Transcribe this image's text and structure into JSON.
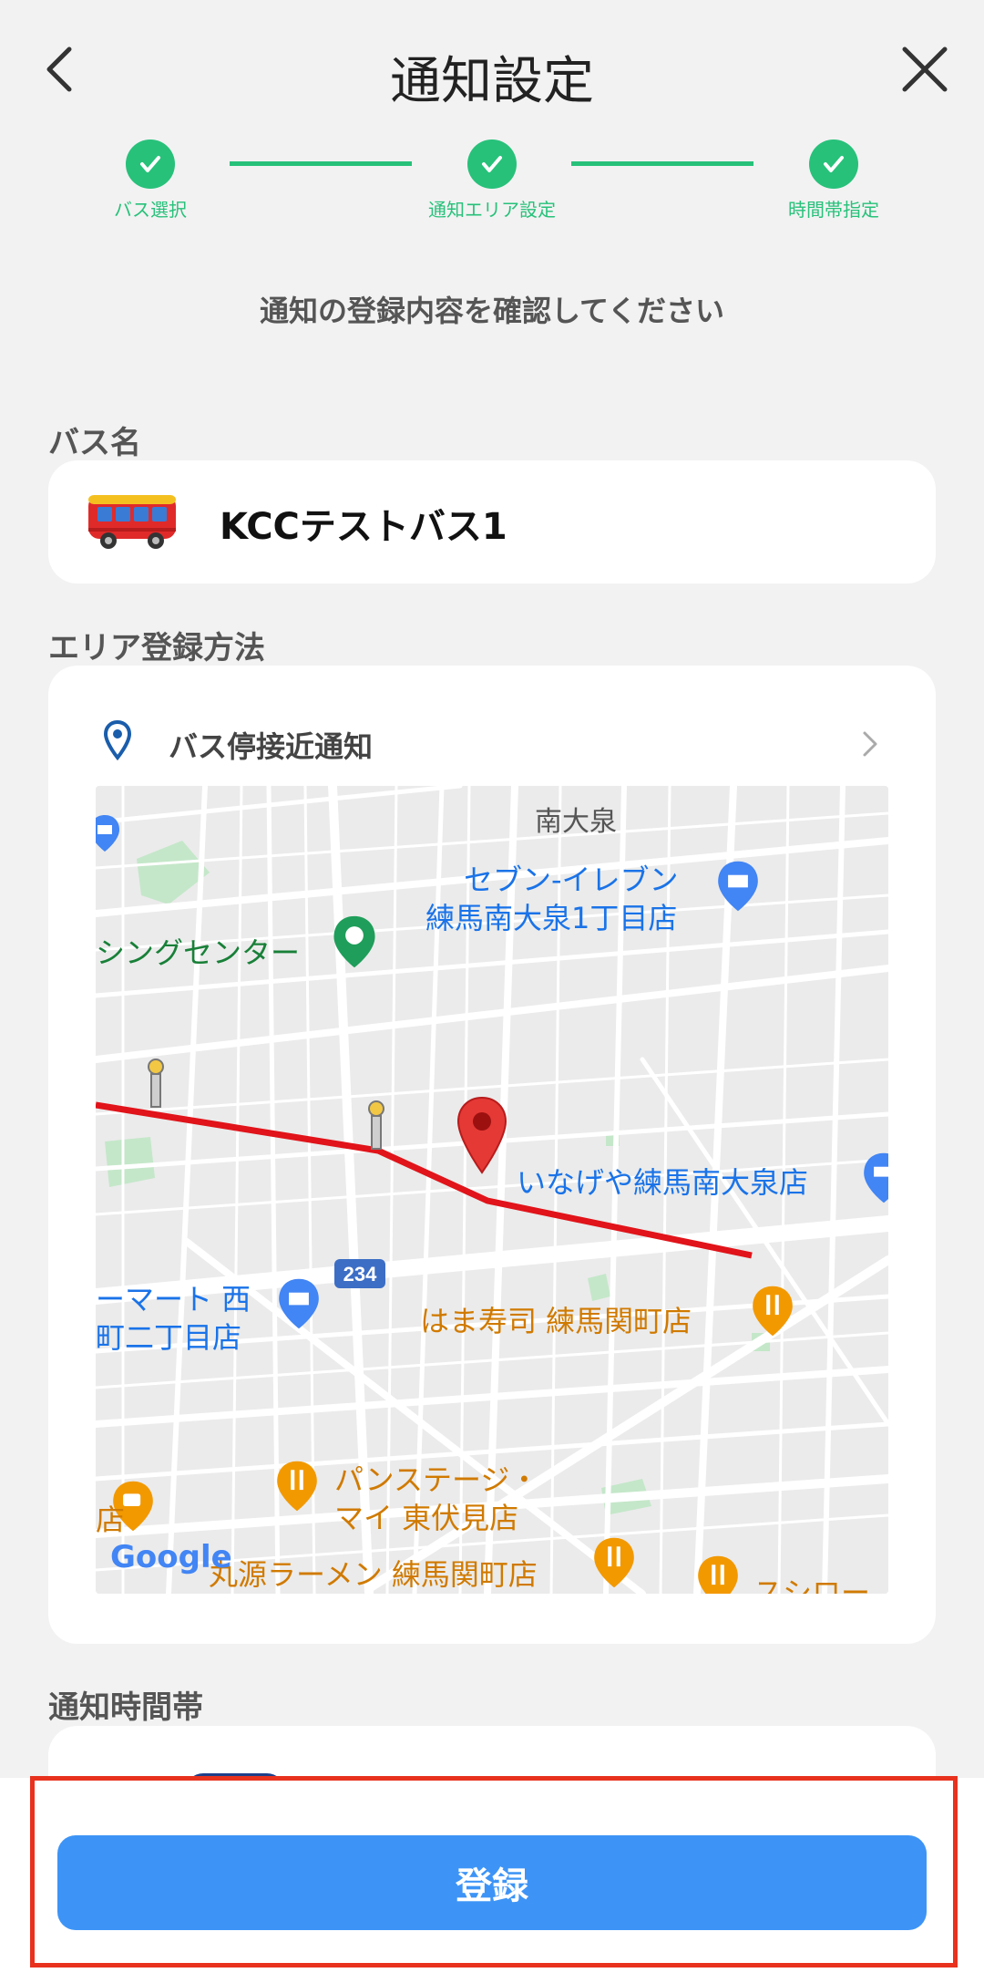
{
  "header": {
    "title": "通知設定",
    "back_icon": "chevron-left-icon",
    "close_icon": "close-icon"
  },
  "stepper": {
    "steps": [
      {
        "label": "バス選択",
        "done": true
      },
      {
        "label": "通知エリア設定",
        "done": true
      },
      {
        "label": "時間帯指定",
        "done": true
      }
    ],
    "accent": "#27c17a"
  },
  "instruction": "通知の登録内容を確認してください",
  "bus_section": {
    "label": "バス名",
    "icon": "bus-icon",
    "bus_name": "KCCテストバス1"
  },
  "area_section": {
    "label": "エリア登録方法",
    "method": "バス停接近通知",
    "pin_icon": "location-pin-icon",
    "chevron_icon": "chevron-right-icon",
    "map": {
      "labels": {
        "area_minami_oizumi": "南大泉",
        "seven_1": "セブン-イレブン",
        "seven_2": "練馬南大泉1丁目店",
        "shopping_center": "シングセンター",
        "inageya": "いなげや練馬南大泉店",
        "route_no": "234",
        "family_1": "ーマート 西",
        "family_2": "町二丁目店",
        "hamasushi": "はま寿司 練馬関町店",
        "panstage_1": "パンステージ・",
        "panstage_2": "マイ 東伏見店",
        "ramen": "丸源ラーメン 練馬関町店",
        "sushiro": "スシロー",
        "cafe_partial": "店",
        "google": "Google"
      }
    }
  },
  "time_section": {
    "label": "通知時間帯"
  },
  "footer": {
    "register_label": "登録",
    "button_color": "#3d94f6",
    "highlight_color": "#e8321e"
  }
}
